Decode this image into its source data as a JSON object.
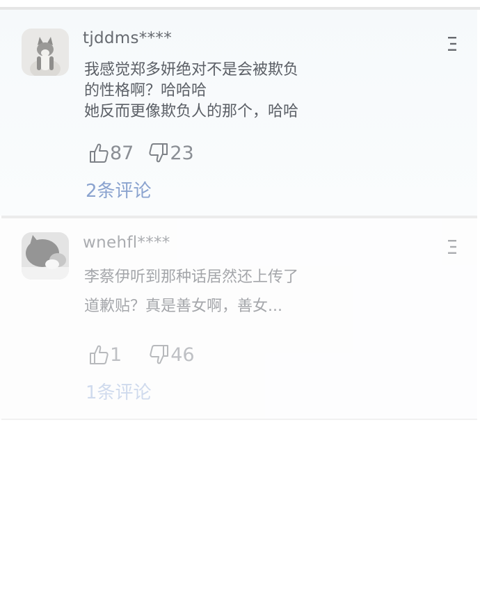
{
  "comments": [
    {
      "username": "tjddms****",
      "lines": [
        "我感觉郑多妍绝对不是会被欺负",
        "的性格啊？哈哈哈",
        "她反而更像欺负人的那个，哈哈"
      ],
      "likes": "87",
      "dislikes": "23",
      "replies": "2条评论",
      "avatar_icon": "cat-avatar-icon",
      "menu_icon": "more-menu-icon"
    },
    {
      "username": "wnehfl****",
      "lines": [
        "李蔡伊听到那种话居然还上传了",
        "道歉贴？真是善女啊，善女..."
      ],
      "likes": "1",
      "dislikes": "46",
      "replies": "1条评论",
      "avatar_icon": "cat-avatar-icon",
      "menu_icon": "more-menu-icon"
    }
  ],
  "colors": {
    "reply_link": "#8aa3cf",
    "text": "#5b5f66",
    "divider": "#ececec"
  }
}
